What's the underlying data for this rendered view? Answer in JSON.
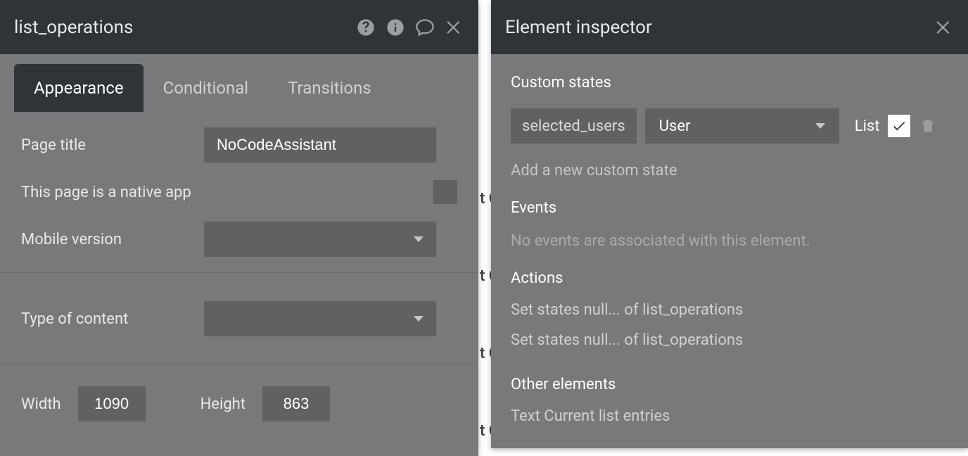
{
  "left_panel": {
    "title": "list_operations",
    "tabs": {
      "appearance": "Appearance",
      "conditional": "Conditional",
      "transitions": "Transitions"
    },
    "fields": {
      "page_title_label": "Page title",
      "page_title_value": "NoCodeAssistant",
      "native_app_label": "This page is a native app",
      "native_app_checked": false,
      "mobile_version_label": "Mobile version",
      "mobile_version_value": "",
      "type_of_content_label": "Type of content",
      "type_of_content_value": "",
      "width_label": "Width",
      "width_value": "1090",
      "height_label": "Height",
      "height_value": "863"
    }
  },
  "right_panel": {
    "title": "Element inspector",
    "custom_states": {
      "heading": "Custom states",
      "state_name": "selected_users",
      "state_type": "User",
      "list_label": "List",
      "list_checked": true,
      "add_link": "Add a new custom state"
    },
    "events": {
      "heading": "Events",
      "empty": "No events are associated with this element."
    },
    "actions": {
      "heading": "Actions",
      "items": [
        "Set states null... of list_operations",
        "Set states null... of list_operations"
      ]
    },
    "other_elements": {
      "heading": "Other elements",
      "items": [
        "Text Current list entries"
      ]
    }
  },
  "artifacts": [
    "t C",
    "t C",
    "t C",
    "t C"
  ]
}
